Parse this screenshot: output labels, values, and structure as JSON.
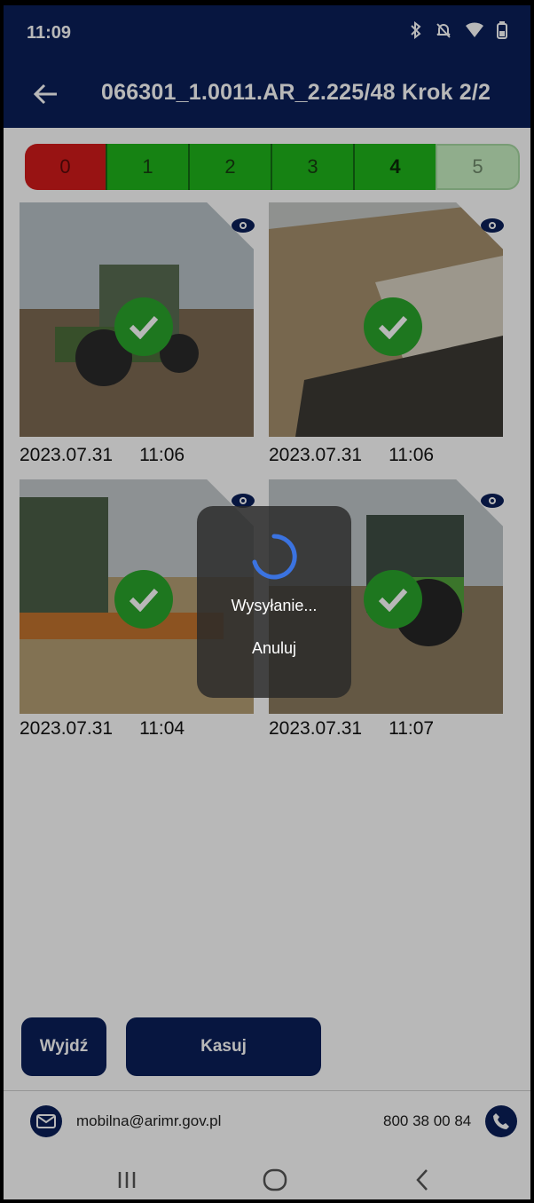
{
  "status_bar": {
    "time": "11:09",
    "icons": [
      "bluetooth-icon",
      "bell-off-icon",
      "wifi-icon",
      "battery-icon"
    ]
  },
  "app_bar": {
    "title": "066301_1.0011.AR_2.225/48 Krok 2/2"
  },
  "steps": [
    "0",
    "1",
    "2",
    "3",
    "4",
    "5"
  ],
  "photos": [
    {
      "date": "2023.07.31",
      "time": "11:06"
    },
    {
      "date": "2023.07.31",
      "time": "11:06"
    },
    {
      "date": "2023.07.31",
      "time": "11:04"
    },
    {
      "date": "2023.07.31",
      "time": "11:07"
    }
  ],
  "buttons": {
    "exit_label": "Wyjdź",
    "delete_label": "Kasuj"
  },
  "footer": {
    "email": "mobilna@arimr.gov.pl",
    "phone": "800 38 00 84"
  },
  "dialog": {
    "message": "Wysyłanie...",
    "cancel_label": "Anuluj"
  },
  "colors": {
    "primary": "#0a1f59",
    "step_red": "#d31b1b",
    "step_green": "#1fb51b",
    "step_pending": "#c8f0c2",
    "check_green": "#2aa62c",
    "spinner": "#3b73e0"
  }
}
